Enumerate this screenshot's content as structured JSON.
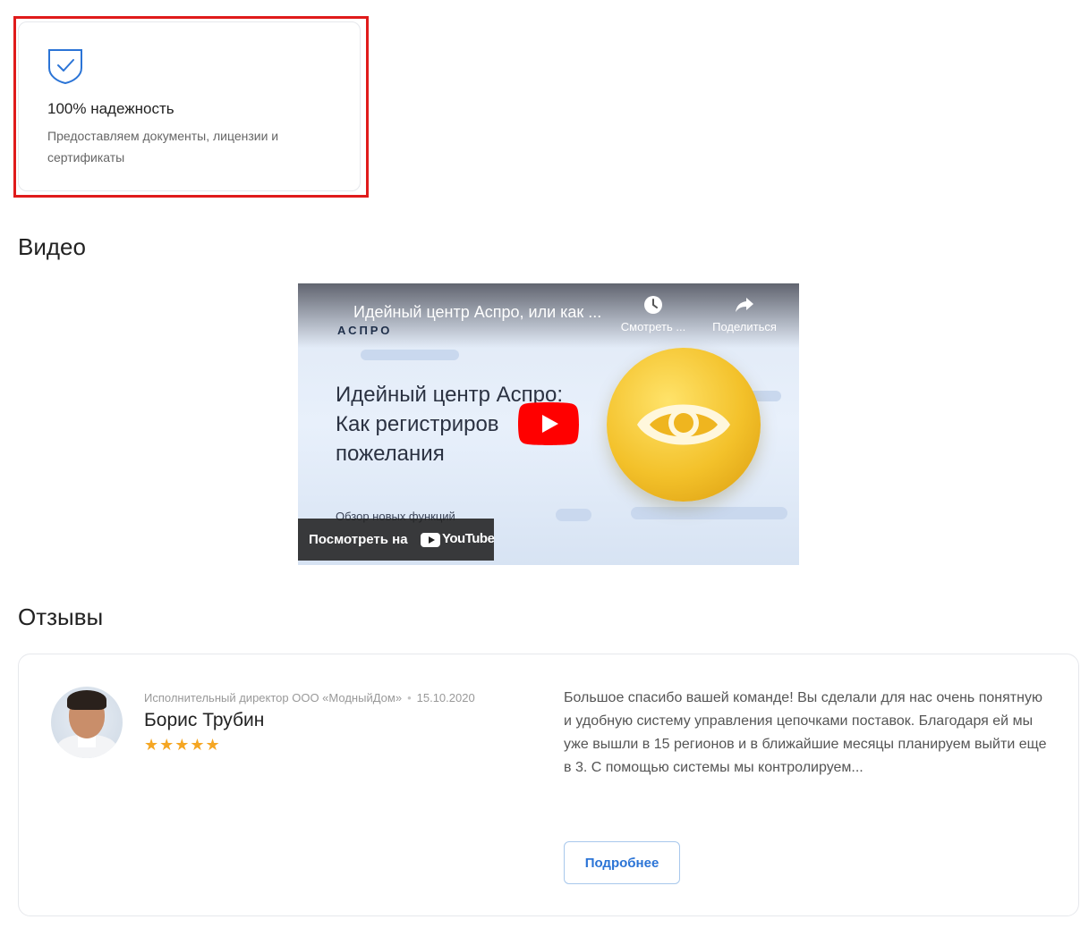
{
  "feature": {
    "icon": "shield-check-icon",
    "title": "100% надежность",
    "text": "Предоставляем документы, лицензии и сертификаты"
  },
  "sections": {
    "video_title": "Видео",
    "reviews_title": "Отзывы"
  },
  "video": {
    "title": "Идейный центр Аспро, или как ...",
    "brand": "АСПРО",
    "watch_later": "Смотреть ...",
    "share": "Поделиться",
    "slide_headline_1": "Идейный центр Аспро:",
    "slide_headline_2": "Как регистриров",
    "slide_headline_3": "пожелания",
    "slide_sub": "Обзор новых функций",
    "watch_on": "Посмотреть на",
    "youtube": "YouTube",
    "play_icon": "play-icon",
    "accent": "#ff0000"
  },
  "review": {
    "position": "Исполнительный директор ООО «МодныйДом»",
    "date": "15.10.2020",
    "author": "Борис Трубин",
    "rating": 5,
    "stars": "★★★★★",
    "text": "Большое спасибо вашей команде! Вы сделали для нас очень понятную и удобную систему управления цепочками поставок. Благодаря ей мы уже вышли в 15 регионов и в ближайшие месяцы планируем выйти еще в 3. С помощью системы мы контролируем...",
    "more_label": "Подробнее"
  },
  "colors": {
    "highlight": "#e01b1b",
    "accent_blue": "#2b74d6",
    "star": "#f5a623"
  }
}
